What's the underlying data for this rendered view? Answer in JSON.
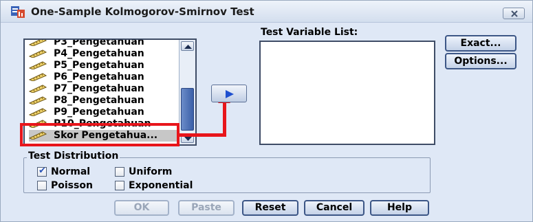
{
  "window": {
    "title": "One-Sample Kolmogorov-Smirnov Test",
    "close_icon": "close-icon"
  },
  "source_list": {
    "items": [
      {
        "label": "P3_Pengetahuan",
        "icon": "scale-variable-icon",
        "selected": false
      },
      {
        "label": "P4_Pengetahuan",
        "icon": "scale-variable-icon",
        "selected": false
      },
      {
        "label": "P5_Pengetahuan",
        "icon": "scale-variable-icon",
        "selected": false
      },
      {
        "label": "P6_Pengetahuan",
        "icon": "scale-variable-icon",
        "selected": false
      },
      {
        "label": "P7_Pengetahuan",
        "icon": "scale-variable-icon",
        "selected": false
      },
      {
        "label": "P8_Pengetahuan",
        "icon": "scale-variable-icon",
        "selected": false
      },
      {
        "label": "P9_Pengetahuan",
        "icon": "scale-variable-icon",
        "selected": false
      },
      {
        "label": "P10_Pengetahuan",
        "icon": "scale-variable-icon",
        "selected": false
      },
      {
        "label": "Skor Pengetahua...",
        "icon": "scale-variable-icon",
        "selected": true
      }
    ]
  },
  "move_button": {
    "icon": "right-arrow-icon"
  },
  "test_variable_list": {
    "label": "Test Variable List:"
  },
  "side_buttons": {
    "exact": "Exact...",
    "options": "Options..."
  },
  "test_distribution": {
    "legend": "Test Distribution",
    "normal": {
      "label": "Normal",
      "checked": true
    },
    "uniform": {
      "label": "Uniform",
      "checked": false
    },
    "poisson": {
      "label": "Poisson",
      "checked": false
    },
    "exponential": {
      "label": "Exponential",
      "checked": false
    }
  },
  "buttons": {
    "ok": "OK",
    "paste": "Paste",
    "reset": "Reset",
    "cancel": "Cancel",
    "help": "Help"
  },
  "colors": {
    "highlight": "#e8151b",
    "accent": "#1f4fcf"
  }
}
